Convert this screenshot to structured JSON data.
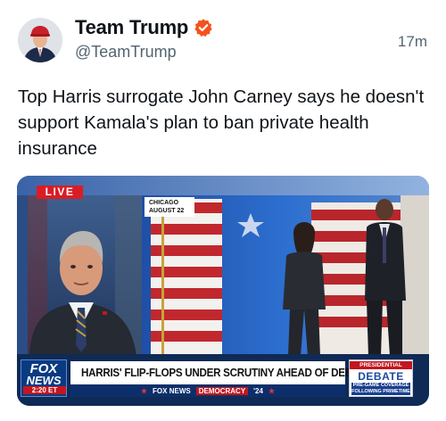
{
  "post": {
    "author_name": "Team Trump",
    "handle": "@TeamTrump",
    "timestamp": "17m",
    "text": "Top Harris surrogate John Carney says he doesn't support Kamala's plan to ban private health insurance",
    "icons": {
      "avatar": "profile-photo",
      "verified": "verified-badge-icon",
      "verified_color": "#f4511e"
    }
  },
  "media": {
    "live_label": "LIVE",
    "location_line1": "CHICAGO",
    "location_line2": "AUGUST 22",
    "network_logo_line1": "FOX",
    "network_logo_line2": "NEWS",
    "network_time": "2:20 ET",
    "headline": "HARRIS' FLIP-FLOPS UNDER SCRUTINY AHEAD OF DEBATE",
    "ticker_brand": "FOX NEWS",
    "ticker_tag": "DEMOCRACY",
    "ticker_year": "'24",
    "debate_top": "PRESIDENTIAL",
    "debate_main": "DEBATE",
    "debate_bottom_line1": "PRE-GAME COVERAGE",
    "debate_bottom_line2": "FOLLOWING PRIMETIME"
  }
}
